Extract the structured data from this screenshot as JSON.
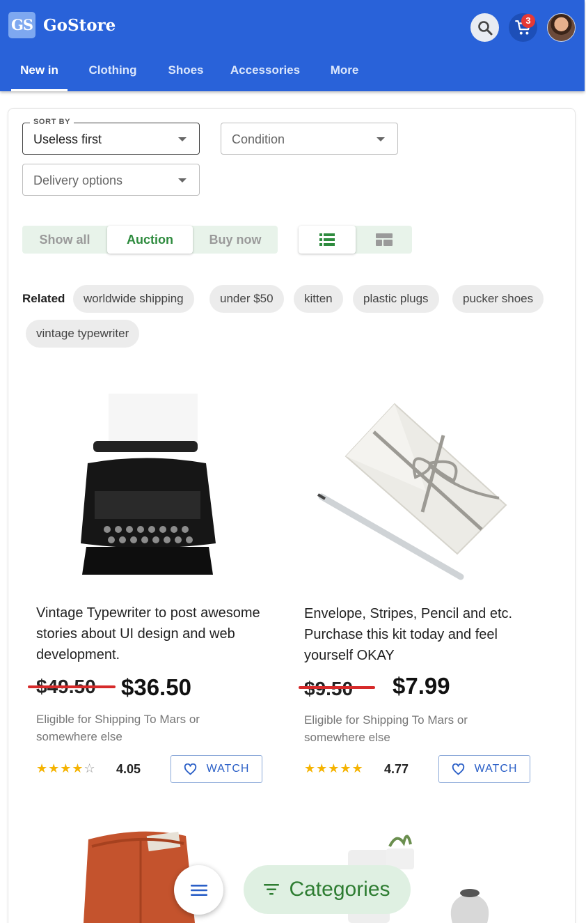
{
  "app": {
    "logo_badge": "GS",
    "name": "GoStore",
    "cart_count": "3"
  },
  "nav": {
    "tabs": [
      "New in",
      "Clothing",
      "Shoes",
      "Accessories",
      "More"
    ],
    "active": "New in"
  },
  "filters": {
    "sort": {
      "label": "SORT BY",
      "value": "Useless first"
    },
    "condition": {
      "value": "Condition"
    },
    "delivery": {
      "value": "Delivery options"
    }
  },
  "listing_type": {
    "options": [
      "Show all",
      "Auction",
      "Buy now"
    ],
    "selected": "Auction"
  },
  "view_mode": {
    "options": [
      "list-icon",
      "grid-icon"
    ],
    "selected": "list-icon"
  },
  "related": {
    "label": "Related",
    "chips": [
      "worldwide shipping",
      "under $50",
      "kitten",
      "plastic plugs",
      "pucker shoes",
      "vintage typewriter"
    ]
  },
  "products": [
    {
      "image": "typewriter-image",
      "description": "Vintage Typewriter to post awesome stories about UI design and web development.",
      "old_price": "$49.50",
      "price": "$36.50",
      "shipping": "Eligible for Shipping To Mars or somewhere else",
      "stars": 4,
      "rating": "4.05",
      "watch_label": "WATCH"
    },
    {
      "image": "envelope-kit-image",
      "description": "Envelope, Stripes, Pencil and etc. Purchase this kit today and feel yourself OKAY",
      "old_price": "$9.50",
      "price": "$7.99",
      "shipping": "Eligible for Shipping To Mars or somewhere else",
      "stars": 5,
      "rating": "4.77",
      "watch_label": "WATCH"
    }
  ],
  "fab": {
    "categories_label": "Categories"
  },
  "colors": {
    "primary": "#2962d9",
    "accent_green": "#2e8b3e",
    "strike_red": "#d62a2a",
    "star": "#f5b301"
  }
}
